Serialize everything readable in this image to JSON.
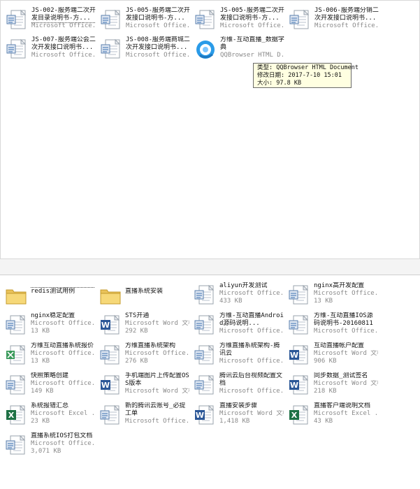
{
  "top_files": [
    {
      "name": "JS-002-服务端二次开发目录说明书-方...",
      "type": "Microsoft Office...",
      "icon": "word-doc-icon",
      "selected": true
    },
    {
      "name": "JS-005-服务端二次开发接口说明书-方...",
      "type": "Microsoft Office...",
      "icon": "word-doc-icon"
    },
    {
      "name": "JS-005-服务端二次开发接口说明书-方...",
      "type": "Microsoft Office...",
      "icon": "word-doc-icon"
    },
    {
      "name": "JS-006-服务端分销二次开发接口说明书...",
      "type": "Microsoft Office...",
      "icon": "word-doc-icon"
    },
    {
      "name": "JS-007-服务端公会二次开发接口说明书...",
      "type": "Microsoft Office...",
      "icon": "word-doc-icon"
    },
    {
      "name": "JS-008-服务端商城二次开发接口说明书...",
      "type": "Microsoft Office...",
      "icon": "word-doc-icon"
    },
    {
      "name": "方维-互动直播_数据字典",
      "type": "QQBrowser HTML D...",
      "icon": "qqbrowser-html-icon"
    }
  ],
  "tooltip": {
    "type_line": "类型: QQBrowser HTML Document",
    "date_line": "修改日期: 2017-7-10 15:01",
    "size_line": "大小: 97.8 KB"
  },
  "bottom_files": [
    {
      "name": "redis测试用例",
      "icon": "folder-icon",
      "folder": true,
      "selected": true
    },
    {
      "name": "直播系统安装",
      "icon": "folder-icon",
      "folder": true
    },
    {
      "name": "aliyun开发测试",
      "type": "Microsoft Office...",
      "size": "433 KB",
      "icon": "word-doc-icon"
    },
    {
      "name": "nginx高开发配置",
      "type": "Microsoft Office...",
      "size": "13 KB",
      "icon": "word-doc-icon"
    },
    {
      "name": "nginx稳定配置",
      "type": "Microsoft Office...",
      "size": "13 KB",
      "icon": "word-doc-icon"
    },
    {
      "name": "STS开通",
      "type": "Microsoft Word 文档",
      "size": "292 KB",
      "icon": "word-w-icon"
    },
    {
      "name": "方维-互动直播Android源码说明...",
      "type": "Microsoft Office...",
      "icon": "word-doc-icon"
    },
    {
      "name": "方维-互动直播IOS源码说明书-20160811",
      "type": "Microsoft Office...",
      "icon": "word-doc-icon"
    },
    {
      "name": "方维互动直播系统报价",
      "type": "Microsoft Office...",
      "size": "13 KB",
      "icon": "excel-doc-icon"
    },
    {
      "name": "方维直播系统架构",
      "type": "Microsoft Office...",
      "size": "276 KB",
      "icon": "word-doc-icon"
    },
    {
      "name": "方维直播系统架构-腾讯云",
      "type": "Microsoft Office...",
      "icon": "word-doc-icon"
    },
    {
      "name": "互动直播帐户配置",
      "type": "Microsoft Word 文档",
      "size": "906 KB",
      "icon": "word-w-icon"
    },
    {
      "name": "快照策略创建",
      "type": "Microsoft Office...",
      "size": "149 KB",
      "icon": "word-doc-icon"
    },
    {
      "name": "手机端图片上传配置OSS版本",
      "type": "Microsoft Word 文档",
      "icon": "word-w-icon"
    },
    {
      "name": "腾讯云后台视频配置文档",
      "type": "Microsoft Office...",
      "icon": "word-doc-icon"
    },
    {
      "name": "同步数据_测试签名",
      "type": "Microsoft Word 文档",
      "size": "218 KB",
      "icon": "word-w-icon"
    },
    {
      "name": "系统报错汇总",
      "type": "Microsoft Excel ...",
      "size": "23 KB",
      "icon": "excel-icon"
    },
    {
      "name": "新的腾讯云账号_必提工单",
      "type": "Microsoft Office...",
      "icon": "word-doc-icon"
    },
    {
      "name": "直播安装步骤",
      "type": "Microsoft Word 文档",
      "size": "1,418 KB",
      "icon": "word-w-icon"
    },
    {
      "name": "直播客户端说明文档",
      "type": "Microsoft Excel ...",
      "size": "43 KB",
      "icon": "excel-icon"
    },
    {
      "name": "直播系统IOS打包文档",
      "type": "Microsoft Office...",
      "size": "3,071 KB",
      "icon": "word-doc-icon"
    }
  ]
}
